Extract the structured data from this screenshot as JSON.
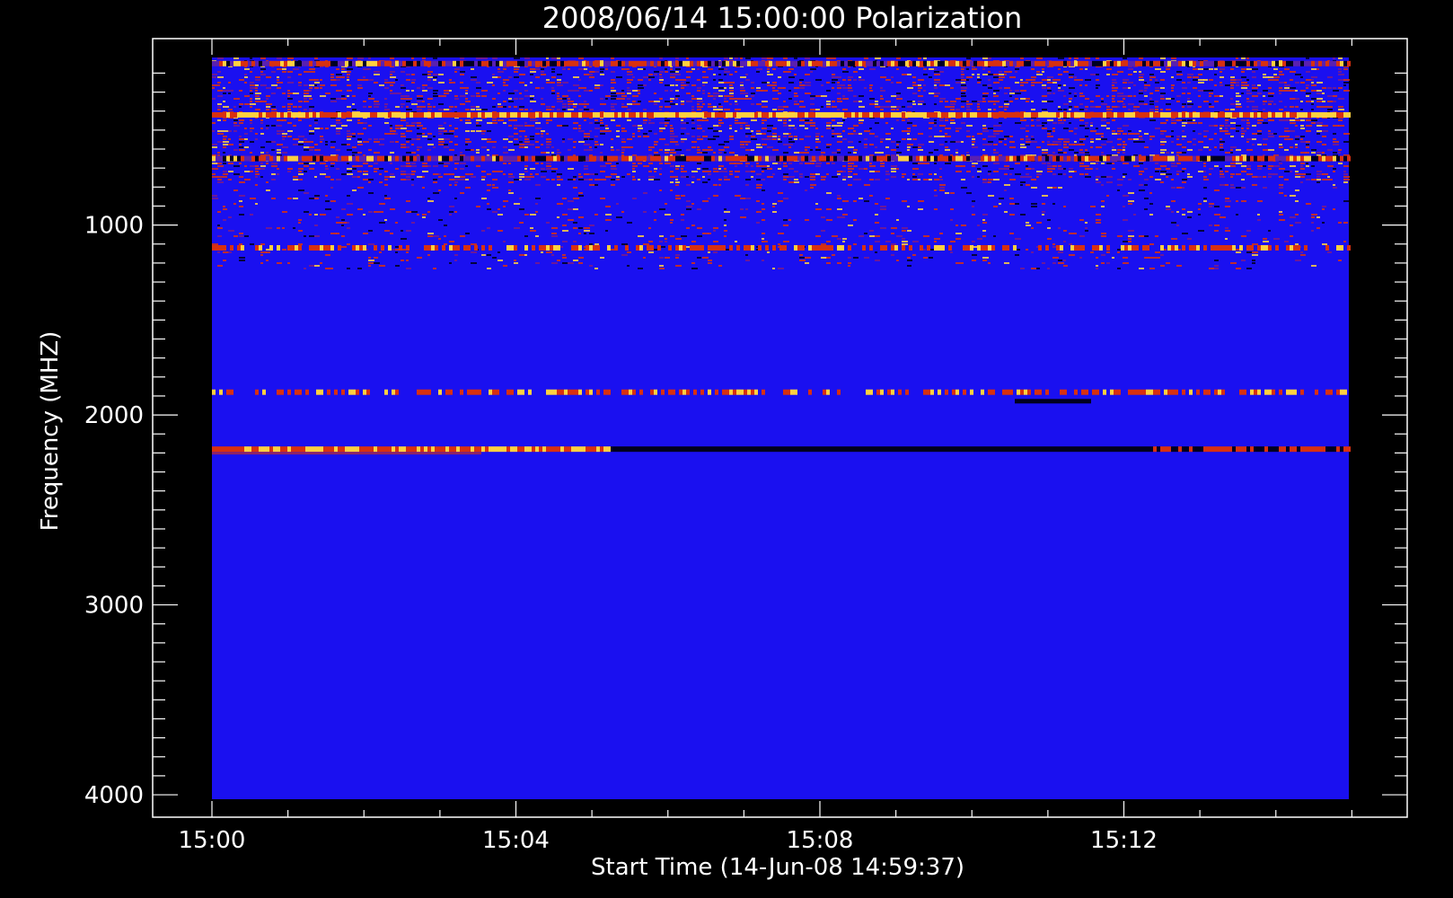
{
  "chart_data": {
    "type": "heatmap",
    "title": "2008/06/14 15:00:00 Polarization",
    "xlabel": "Start Time (14-Jun-08 14:59:37)",
    "ylabel": "Frequency (MHZ)",
    "x_ticks": [
      "15:00",
      "15:04",
      "15:08",
      "15:12"
    ],
    "y_ticks": [
      "1000",
      "2000",
      "3000",
      "4000"
    ],
    "x_range_minutes_after_1500": [
      0,
      15
    ],
    "y_range_mhz": [
      100,
      4000
    ],
    "y_axis_reversed": true,
    "grid": false,
    "colors": {
      "background": "#000000",
      "axes": "#ffffff",
      "base": "#1a10f0",
      "warm": "#d83010",
      "hot": "#ffd040",
      "dark": "#000020"
    },
    "bands": [
      {
        "freq_mhz": 150,
        "intensity": "mixed"
      },
      {
        "freq_mhz": 420,
        "intensity": "hot"
      },
      {
        "freq_mhz": 650,
        "intensity": "mixed"
      },
      {
        "freq_mhz": 1120,
        "intensity": "warm"
      },
      {
        "freq_mhz": 1880,
        "intensity": "warm"
      },
      {
        "freq_mhz": 2180,
        "intensity": "hot-then-dark"
      }
    ]
  }
}
